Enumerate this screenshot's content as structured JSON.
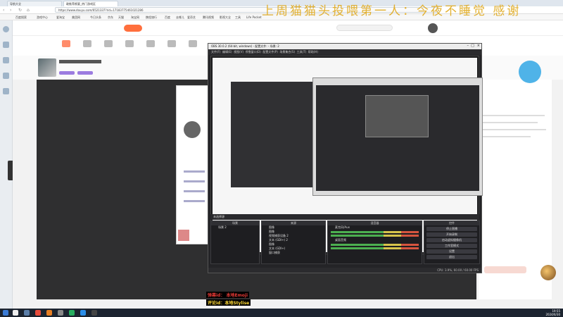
{
  "browser": {
    "tabs": [
      {
        "label": "导航大全"
      },
      {
        "label": "敢推荐颜要_热门游戏区"
      }
    ],
    "url": "https://www.douyu.com/6521337?rid=17183775461021286",
    "bookmarks": [
      "百度搜索",
      "游戏中心",
      "爱淘宝",
      "美团网",
      "今日头条",
      "京东",
      "天猫",
      "淘宝网",
      "携程旅行",
      "百度",
      "去哪儿",
      "爱奇艺",
      "腾讯视频",
      "影视大全",
      "工具",
      "Life Pocket"
    ]
  },
  "overlay": {
    "marquee_text": "上周猫猫头投喂第一人：今夜不睡觉 感谢"
  },
  "obs": {
    "title": "OBS 30.0.2 (64-bit, windows) - 配置文件: - 场景: 2",
    "menu": [
      "文件(F)",
      "编辑(E)",
      "视图(V)",
      "停靠窗口(D)",
      "配置文件(P)",
      "场景集合(S)",
      "工具(T)",
      "帮助(H)"
    ],
    "scene_label": "未选择源",
    "docks": {
      "scenes": {
        "title": "场景",
        "items": [
          "场景 2"
        ]
      },
      "sources": {
        "title": "来源",
        "items": [
          "图像",
          "图像",
          "视频捕获设备 2",
          "文本 (GDI+) 2",
          "图像",
          "文本 (GDI+)",
          "窗口捕获"
        ]
      },
      "mixer": {
        "title": "混音器",
        "channels": [
          "麦克风/Aux",
          "桌面音频"
        ]
      },
      "controls": {
        "title": "控件",
        "buttons": [
          "停止直播",
          "开始录制",
          "启动虚拟摄像机",
          "工作室模式",
          "设置",
          "退出"
        ]
      }
    },
    "status": "CPU: 3.9%, 60.00 / 60.00 FPS"
  },
  "labels": {
    "line1": "弹幕id：  本地Emoji",
    "line2": "评论id：本地Stylise"
  },
  "taskbar": {
    "time": "19:55",
    "date": "2024/6/30"
  },
  "colors": {
    "overlay": "#e0a91c",
    "label_red": "#e53935",
    "label_yellow": "#fdd835"
  }
}
